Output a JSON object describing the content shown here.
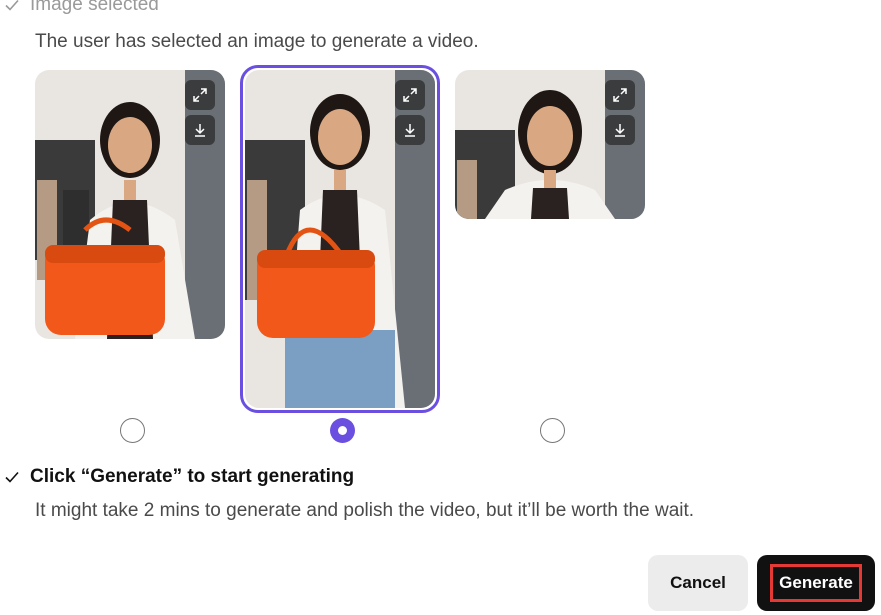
{
  "step1": {
    "title": "Image selected",
    "description": "The user has selected an image to generate a video."
  },
  "images": [
    {
      "id": "image-1",
      "selected": false,
      "icons": [
        "expand-icon",
        "download-icon"
      ]
    },
    {
      "id": "image-2",
      "selected": true,
      "icons": [
        "expand-icon",
        "download-icon"
      ]
    },
    {
      "id": "image-3",
      "selected": false,
      "icons": [
        "expand-icon",
        "download-icon"
      ]
    }
  ],
  "step2": {
    "title": "Click “Generate” to start generating",
    "description": "It might take 2 mins to generate and polish the video, but it’ll be worth the wait."
  },
  "buttons": {
    "cancel": "Cancel",
    "generate": "Generate"
  },
  "colors": {
    "accent": "#6b4fe0",
    "highlight": "#e53935",
    "bag": "#f2581a"
  }
}
